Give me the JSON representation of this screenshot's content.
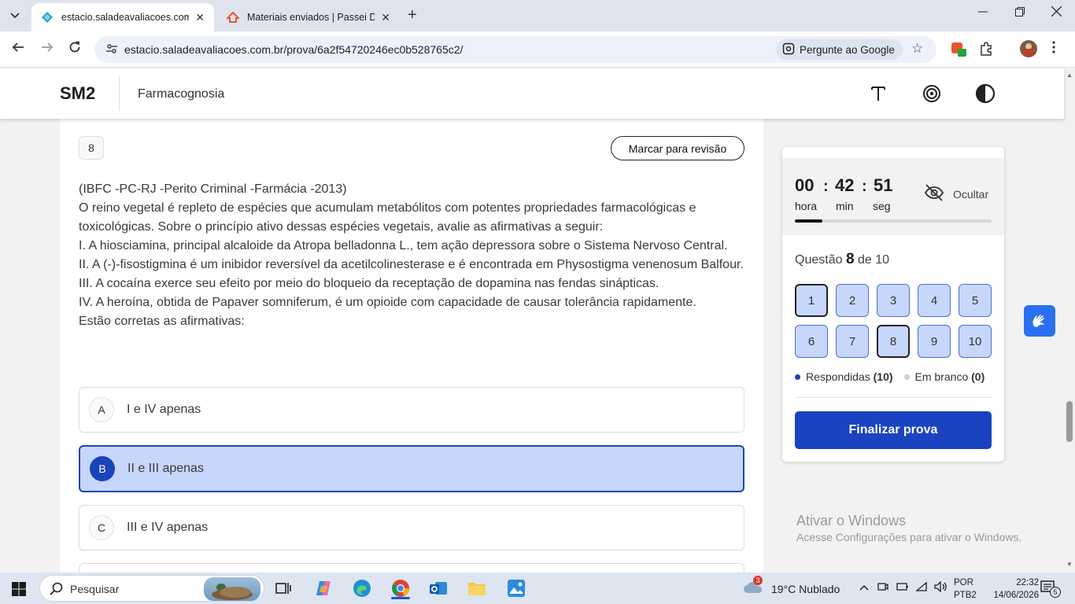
{
  "browser": {
    "tabs": [
      {
        "title": "estacio.saladeavaliacoes.com.br",
        "active": true
      },
      {
        "title": "Materiais enviados | Passei Direto",
        "active": false
      }
    ],
    "url": "estacio.saladeavaliacoes.com.br/prova/6a2f54720246ec0b528765c2/",
    "ask_google": "Pergunte ao Google"
  },
  "header": {
    "brand": "SM2",
    "course": "Farmacognosia"
  },
  "question": {
    "number": "8",
    "review_label": "Marcar para revisão",
    "lines": [
      "(IBFC -PC-RJ -Perito Criminal -Farmácia -2013)",
      "O reino vegetal é repleto de espécies que acumulam metabólitos com potentes propriedades farmacológicas e toxicológicas. Sobre o princípio ativo dessas espécies vegetais, avalie as afirmativas a seguir:",
      "I. A hiosciamina, principal alcaloide da Atropa belladonna L., tem ação depressora sobre o Sistema Nervoso Central.",
      "II. A (-)-fisostigmina é um inibidor reversível da acetilcolinesterase e é encontrada em Physostigma venenosum Balfour.",
      "III. A cocaína exerce seu efeito por meio do bloqueio da receptação de dopamina nas fendas sinápticas.",
      "IV. A heroína, obtida de Papaver somniferum, é um opioide com capacidade de causar tolerância rapidamente.",
      "Estão corretas as afirmativas:"
    ],
    "options": [
      {
        "letter": "A",
        "text": "I e IV apenas",
        "selected": false
      },
      {
        "letter": "B",
        "text": "II e III apenas",
        "selected": true
      },
      {
        "letter": "C",
        "text": "III e IV apenas",
        "selected": false
      }
    ]
  },
  "timer": {
    "hours": "00",
    "hours_label": "hora",
    "minutes": "42",
    "minutes_label": "min",
    "seconds": "51",
    "seconds_label": "seg",
    "hide_label": "Ocultar",
    "progress_fraction": 0.14
  },
  "progress": {
    "prefix": "Questão",
    "current": "8",
    "suffix": "de 10",
    "questions": [
      "1",
      "2",
      "3",
      "4",
      "5",
      "6",
      "7",
      "8",
      "9",
      "10"
    ],
    "answered_label": "Respondidas",
    "answered_count": "(10)",
    "blank_label": "Em branco",
    "blank_count": "(0)",
    "finish_label": "Finalizar prova"
  },
  "watermark": {
    "line1": "Ativar o Windows",
    "line2": "Acesse Configurações para ativar o Windows."
  },
  "taskbar": {
    "search_placeholder": "Pesquisar",
    "weather_badge": "3",
    "weather": "19°C  Nublado",
    "lang1": "POR",
    "lang2": "PTB2",
    "time": "22:32",
    "date": "14/06/2026",
    "notif_count": "5"
  },
  "colors": {
    "accent": "#1a43c2",
    "selected_bg": "#c7d6fb",
    "answered_dot": "#1a43b8",
    "blank_dot": "#d0d0d0"
  }
}
